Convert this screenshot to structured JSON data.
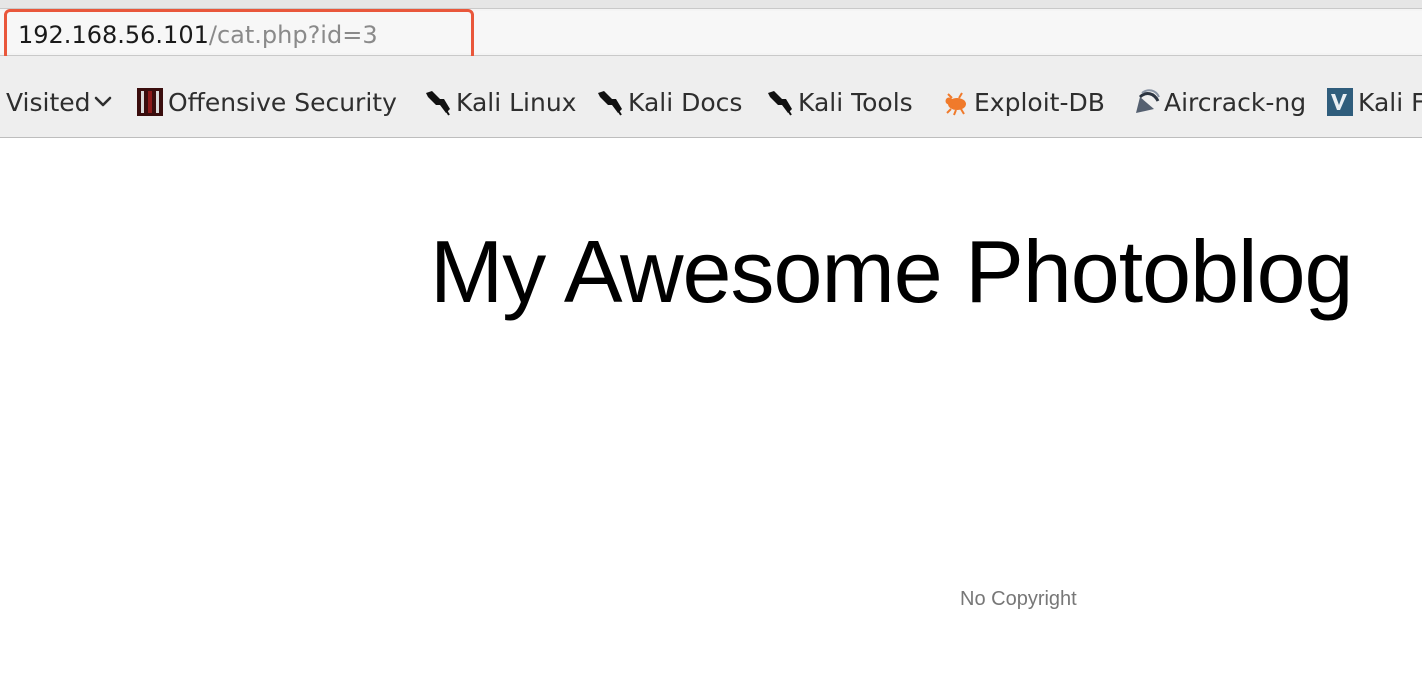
{
  "browser": {
    "url": {
      "host": "192.168.56.101",
      "path": "/cat.php?id=3"
    },
    "bookmarks": [
      {
        "label": "Visited",
        "icon": "chevron-down-icon"
      },
      {
        "label": "Offensive Security",
        "icon": "offensive-security-icon"
      },
      {
        "label": "Kali Linux",
        "icon": "kali-dragon-icon"
      },
      {
        "label": "Kali Docs",
        "icon": "kali-dragon-icon"
      },
      {
        "label": "Kali Tools",
        "icon": "kali-dragon-icon"
      },
      {
        "label": "Exploit-DB",
        "icon": "exploit-db-bug-icon"
      },
      {
        "label": "Aircrack-ng",
        "icon": "aircrack-ng-icon"
      },
      {
        "label": "Kali F",
        "icon": "kali-forums-icon"
      }
    ],
    "highlight_color": "#e9573b"
  },
  "page": {
    "title": "My Awesome Photoblog",
    "footer": "No Copyright"
  }
}
